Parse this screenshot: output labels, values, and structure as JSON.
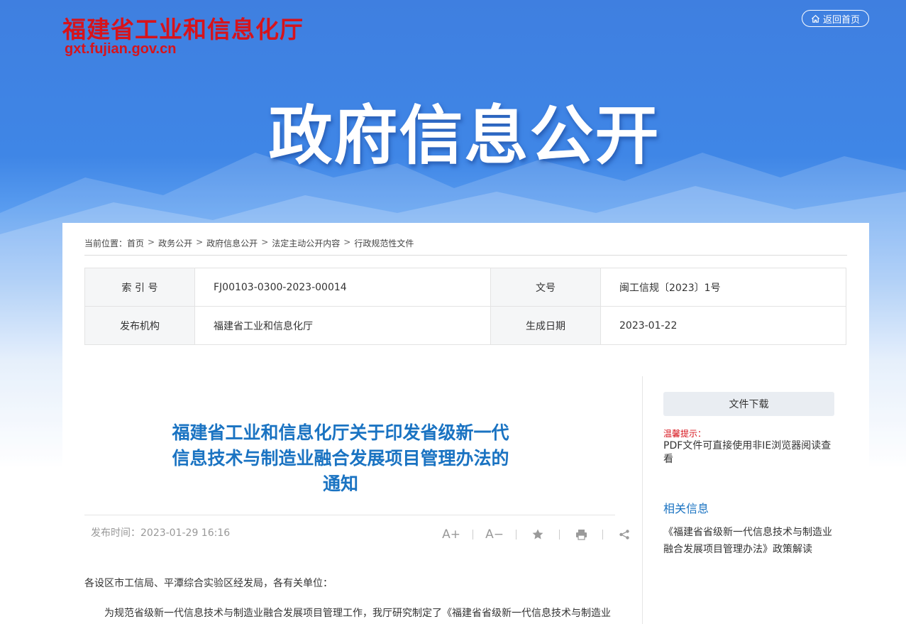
{
  "header": {
    "site_name": "福建省工业和信息化厅",
    "site_domain": "gxt.fujian.gov.cn",
    "home_link": "返回首页",
    "banner_title": "政府信息公开"
  },
  "breadcrumb": {
    "prefix": "当前位置：",
    "items": [
      "首页",
      "政务公开",
      "政府信息公开",
      "法定主动公开内容",
      "行政规范性文件"
    ],
    "separator": ">"
  },
  "meta": {
    "index_label": "索 引 号",
    "index_value": "FJ00103-0300-2023-00014",
    "docno_label": "文号",
    "docno_value": "闽工信规〔2023〕1号",
    "issuer_label": "发布机构",
    "issuer_value": "福建省工业和信息化厅",
    "date_label": "生成日期",
    "date_value": "2023-01-22"
  },
  "article": {
    "title_lines": [
      "福建省工业和信息化厅关于印发省级新一代",
      "信息技术与制造业融合发展项目管理办法的",
      "通知"
    ],
    "publish_time": "发布时间：2023-01-29 16:16",
    "tools": {
      "font_increase": "A+",
      "font_decrease": "A−"
    },
    "salutation": "各设区市工信局、平潭综合实验区经发局，各有关单位：",
    "body_first_line": "为规范省级新一代信息技术与制造业融合发展项目管理工作，我厅研究制定了《福建省省级新一代信息技术与制造业"
  },
  "sidebar": {
    "download_label": "文件下载",
    "tip_title": "温馨提示：",
    "tip_text": "PDF文件可直接使用非IE浏览器阅读查看",
    "related_title": "相关信息",
    "related_item": "《福建省省级新一代信息技术与制造业融合发展项目管理办法》政策解读"
  },
  "colors": {
    "brand_red": "#d7131b",
    "title_blue": "#1a73c2",
    "banner_blue": "#3f7fe0"
  }
}
